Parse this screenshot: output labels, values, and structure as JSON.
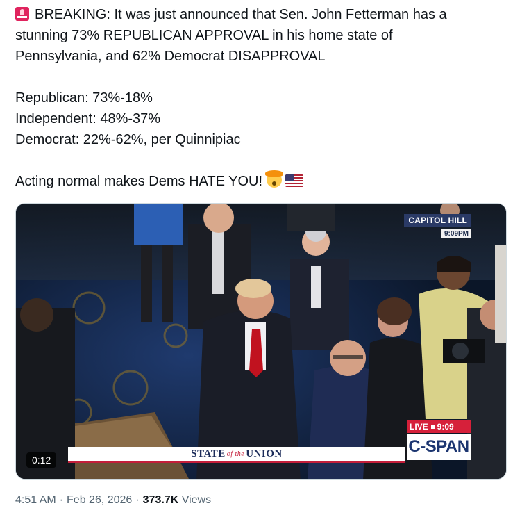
{
  "tweet": {
    "lines": [
      "BREAKING: It was just announced that Sen. John Fetterman has a",
      "stunning 73% REPUBLICAN APPROVAL in his home state of",
      "Pennsylvania, and 62% Democrat DISAPPROVAL",
      "Republican: 73%-18%",
      "Independent: 48%-37%",
      "Democrat: 22%-62%, per Quinnipiac",
      "Acting normal makes Dems HATE YOU!"
    ],
    "lead_icon": "rotating-light-icon",
    "trailing_icons": [
      "exploding-head-icon",
      "us-flag-icon"
    ]
  },
  "video": {
    "location_label": "CAPITOL HILL",
    "location_time": "9:09PM",
    "live_label": "LIVE",
    "live_time": "9:09",
    "network": "C-SPAN",
    "banner": {
      "state": "STATE",
      "of_the": "of the",
      "union": "UNION"
    },
    "duration": "0:12"
  },
  "meta": {
    "time": "4:51 AM",
    "date": "Feb 26, 2026",
    "views_count": "373.7K",
    "views_label": "Views",
    "separator": "·"
  },
  "colors": {
    "text": "#0f1419",
    "muted": "#536471",
    "cspan_blue": "#1c3570",
    "live_red": "#d6203a"
  }
}
